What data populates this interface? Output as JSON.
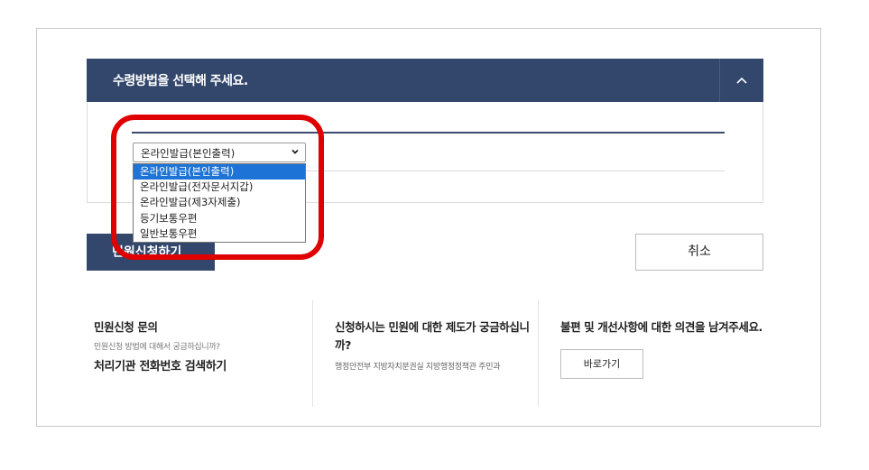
{
  "panel": {
    "title": "수령방법을 선택해 주세요."
  },
  "select": {
    "current_value": "온라인발급(본인출력)",
    "options": [
      "온라인발급(본인출력)",
      "온라인발급(전자문서지갑)",
      "온라인발급(제3자제출)",
      "등기보통우편",
      "일반보통우편"
    ],
    "highlighted_index": 0
  },
  "buttons": {
    "apply_label_visible": "민원신청하기",
    "cancel_label": "취소"
  },
  "info": {
    "inquiry": {
      "title": "민원신청 문의",
      "subtitle": "민원신청 방법에 대해서 궁금하십니까?",
      "link": "처리기관 전화번호 검색하기"
    },
    "system": {
      "title": "신청하시는 민원에 대한 제도가 궁금하십니까?",
      "dept": "행정안전부 지방자치분권실 지방행정정책관 주민과"
    },
    "feedback": {
      "title": "불편 및 개선사항에 대한 의견을 남겨주세요.",
      "button": "바로가기"
    }
  },
  "colors": {
    "header_bg": "#33466b",
    "highlight_ring": "#e00000",
    "option_selected_bg": "#1e74d6"
  }
}
